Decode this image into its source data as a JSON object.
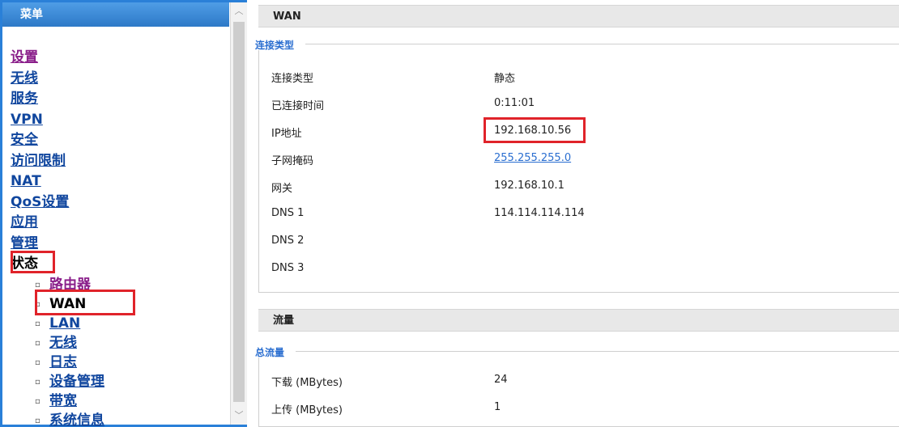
{
  "menu": {
    "header": "菜单",
    "items": [
      {
        "label": "设置",
        "state": "visited"
      },
      {
        "label": "无线",
        "state": "link"
      },
      {
        "label": "服务",
        "state": "link"
      },
      {
        "label": "VPN",
        "state": "link"
      },
      {
        "label": "安全",
        "state": "link"
      },
      {
        "label": "访问限制",
        "state": "link"
      },
      {
        "label": "NAT",
        "state": "link"
      },
      {
        "label": "QoS设置",
        "state": "link"
      },
      {
        "label": "应用",
        "state": "link"
      },
      {
        "label": "管理",
        "state": "link"
      },
      {
        "label": "状态",
        "state": "current"
      }
    ],
    "status_submenu": [
      {
        "label": "路由器",
        "state": "visited"
      },
      {
        "label": "WAN",
        "state": "current"
      },
      {
        "label": "LAN",
        "state": "link"
      },
      {
        "label": "无线",
        "state": "link"
      },
      {
        "label": "日志",
        "state": "link"
      },
      {
        "label": "设备管理",
        "state": "link"
      },
      {
        "label": "带宽",
        "state": "link"
      },
      {
        "label": "系统信息",
        "state": "link"
      }
    ]
  },
  "wan": {
    "title": "WAN",
    "fieldset_title": "连接类型",
    "rows": [
      {
        "label": "连接类型",
        "value": "静态"
      },
      {
        "label": "已连接时间",
        "value": "0:11:01"
      },
      {
        "label": "IP地址",
        "value": "192.168.10.56"
      },
      {
        "label": "子网掩码",
        "value": "255.255.255.0"
      },
      {
        "label": "网关",
        "value": "192.168.10.1"
      },
      {
        "label": "DNS 1",
        "value": "114.114.114.114"
      },
      {
        "label": "DNS 2",
        "value": ""
      },
      {
        "label": "DNS 3",
        "value": ""
      }
    ]
  },
  "traffic": {
    "title": "流量",
    "fieldset_title": "总流量",
    "rows": [
      {
        "label": "下载 (MBytes)",
        "value": "24"
      },
      {
        "label": "上传 (MBytes)",
        "value": "1"
      }
    ]
  },
  "colors": {
    "frame_border": "#2a80d8",
    "link": "#10469e",
    "visited": "#8a1f8a",
    "highlight": "#e0232a"
  },
  "icons": {
    "scroll_up": "chevron-up-icon",
    "scroll_down": "chevron-down-icon"
  }
}
